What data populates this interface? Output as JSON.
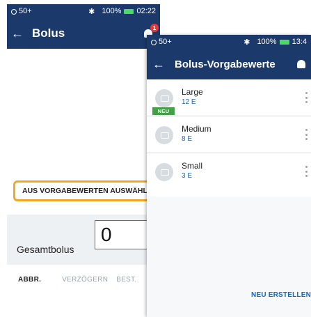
{
  "back_screen": {
    "status": {
      "notif": "50+",
      "battery": "100%",
      "time": "02:22"
    },
    "title": "Bolus",
    "badge_count": "1",
    "preset_button": "AUS VORGABEWERTEN AUSWÄHLEN",
    "total": {
      "label": "Gesamtbolus",
      "value": "0"
    },
    "actions": {
      "cancel": "ABBR.",
      "delay": "VERZÖGERN",
      "confirm": "BEST."
    }
  },
  "front_screen": {
    "status": {
      "notif": "50+",
      "battery": "100%",
      "time": "13:4"
    },
    "title": "Bolus-Vorgabewerte",
    "presets": [
      {
        "name": "Large",
        "value": "12 E",
        "tag": "NEU"
      },
      {
        "name": "Medium",
        "value": "8 E"
      },
      {
        "name": "Small",
        "value": "3 E"
      }
    ],
    "create_button": "NEU ERSTELLEN"
  },
  "colors": {
    "header": "#1b3a6b",
    "accent_orange": "#f5a623",
    "link_blue": "#1565c0",
    "new_green": "#43a047",
    "badge_red": "#e53935"
  },
  "icons": [
    "back-arrow-icon",
    "bell-icon",
    "bluetooth-icon",
    "battery-icon",
    "bolus-avatar-icon",
    "more-vert-icon"
  ]
}
